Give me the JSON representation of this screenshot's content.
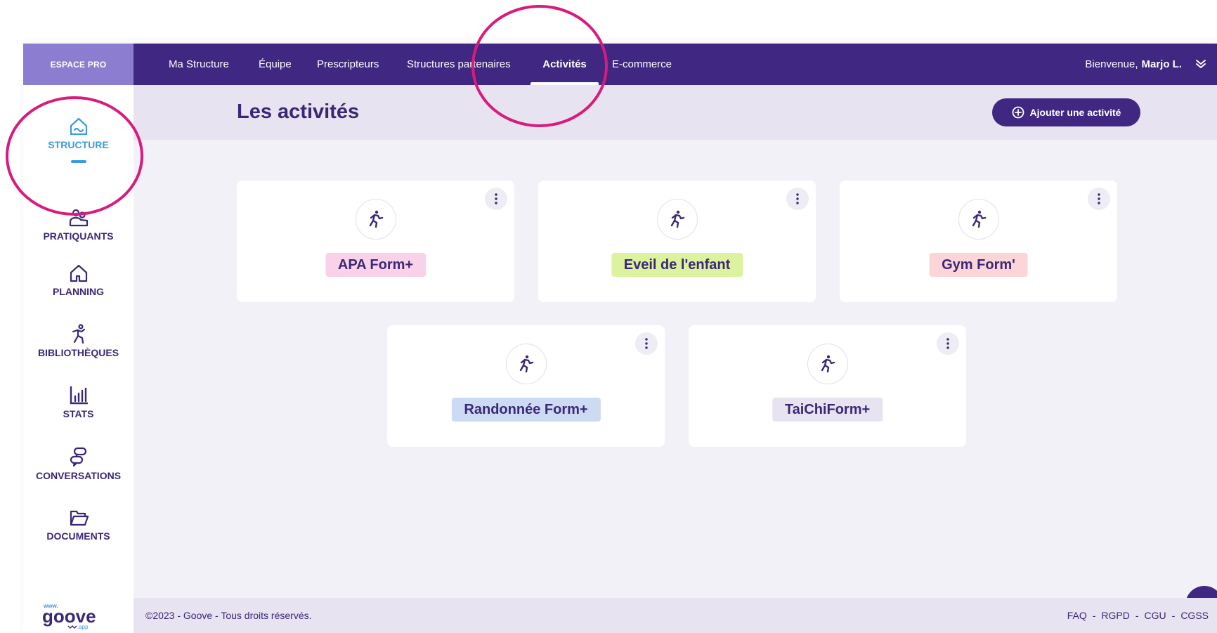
{
  "sidebar": {
    "espace_label": "ESPACE PRO",
    "items": [
      {
        "label": "STRUCTURE",
        "icon": "structure-house-icon",
        "active": true
      },
      {
        "label": "PRATIQUANTS",
        "icon": "users-icon"
      },
      {
        "label": "PLANNING",
        "icon": "house-icon"
      },
      {
        "label": "BIBLIOTHÈQUES",
        "icon": "running-person-icon"
      },
      {
        "label": "STATS",
        "icon": "bar-chart-icon"
      },
      {
        "label": "CONVERSATIONS",
        "icon": "chat-bubbles-icon"
      },
      {
        "label": "DOCUMENTS",
        "icon": "folder-icon"
      }
    ],
    "logo": {
      "prefix": "www.",
      "name": "goove",
      "suffix": ".app"
    }
  },
  "topnav": {
    "tabs": [
      {
        "label": "Ma Structure"
      },
      {
        "label": "Équipe"
      },
      {
        "label": "Prescripteurs"
      },
      {
        "label": "Structures partenaires"
      },
      {
        "label": "Activités",
        "active": true
      },
      {
        "label": "E-commerce"
      }
    ],
    "welcome_text": "Bienvenue,",
    "user_name": "Marjo L."
  },
  "header": {
    "title": "Les activités",
    "add_button_label": "Ajouter une activité"
  },
  "activities": [
    {
      "name": "APA Form+",
      "color": "#f9d2ea"
    },
    {
      "name": "Eveil de l'enfant",
      "color": "#dcf29e"
    },
    {
      "name": "Gym Form'",
      "color": "#fbd5d8"
    },
    {
      "name": "Randonnée Form+",
      "color": "#ccdaf4"
    },
    {
      "name": "TaiChiForm+",
      "color": "#e7e3f0"
    }
  ],
  "footer": {
    "copyright": "©2023 - Goove - Tous droits réservés.",
    "links": [
      "FAQ",
      "RGPD",
      "CGU",
      "CGSS"
    ]
  },
  "colors": {
    "primary": "#3f2782",
    "accent_blue": "#3a9be0",
    "annotation": "#d81b7d"
  }
}
